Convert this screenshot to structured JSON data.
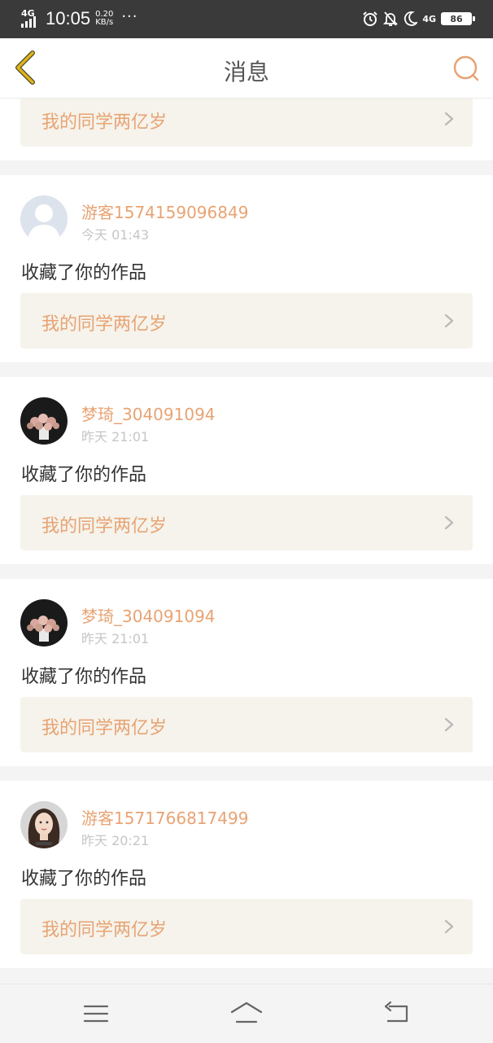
{
  "status_bar": {
    "network": "4G",
    "time": "10:05",
    "speed_value": "0.20",
    "speed_unit": "KB/s",
    "more": "···",
    "network_right": "4G",
    "battery": "86"
  },
  "header": {
    "title": "消息",
    "back_icon": "chevron-left-icon",
    "search_icon": "search-icon"
  },
  "top_partial_card": {
    "work_title": "我的同学两亿岁"
  },
  "messages": [
    {
      "user": "游客1574159096849",
      "time": "今天 01:43",
      "action": "收藏了你的作品",
      "work_title": "我的同学两亿岁",
      "avatar": "default-avatar-icon"
    },
    {
      "user": "梦琦_304091094",
      "time": "昨天 21:01",
      "action": "收藏了你的作品",
      "work_title": "我的同学两亿岁",
      "avatar": "flowers-avatar"
    },
    {
      "user": "梦琦_304091094",
      "time": "昨天 21:01",
      "action": "收藏了你的作品",
      "work_title": "我的同学两亿岁",
      "avatar": "flowers-avatar"
    },
    {
      "user": "游客1571766817499",
      "time": "昨天 20:21",
      "action": "收藏了你的作品",
      "work_title": "我的同学两亿岁",
      "avatar": "portrait-avatar"
    }
  ],
  "bottom_nav": {
    "menu_icon": "menu-icon",
    "home_icon": "home-icon",
    "back_icon": "back-icon"
  },
  "colors": {
    "accent": "#e8a373",
    "title_text": "#555555",
    "link_bg": "#f5f3eb",
    "page_bg": "#f4f4f4",
    "status_bar_bg": "#3a3a3a",
    "back_icon": "#e0b31a",
    "search_icon": "#e8a373"
  }
}
